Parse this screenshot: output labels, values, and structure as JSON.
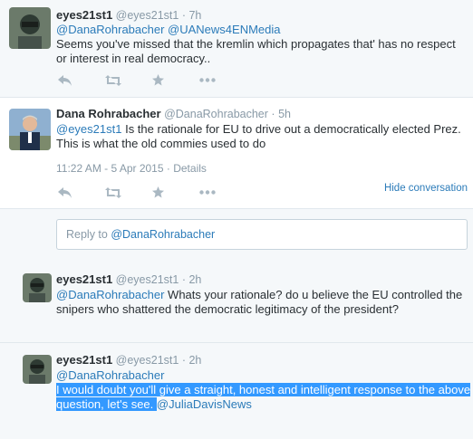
{
  "tweets": [
    {
      "fullname": "eyes21st1",
      "handle": "@eyes21st1",
      "time": "7h",
      "mentions": "@DanaRohrabacher @UANews4ENMedia",
      "text_line1": "Seems you've missed that the kremlin which propagates that' has no respect",
      "text_line2": "or interest in real democracy.."
    },
    {
      "fullname": "Dana Rohrabacher",
      "handle": "@DanaRohrabacher",
      "time": "5h",
      "mention": "@eyes21st1",
      "text_line1": " Is the rationale for EU to drive out a democratically elected Prez.",
      "text_line2": "This is what the old commies used to do",
      "timestamp": "11:22 AM - 5 Apr 2015",
      "details": "Details",
      "hide_conversation": "Hide conversation"
    },
    {
      "fullname": "eyes21st1",
      "handle": "@eyes21st1",
      "time": "2h",
      "mention": "@DanaRohrabacher",
      "text_line1": " Whats your rationale? do u believe the EU controlled the",
      "text_line2": "snipers who shattered the democratic legitimacy of the president?"
    },
    {
      "fullname": "eyes21st1",
      "handle": "@eyes21st1",
      "time": "2h",
      "mention": "@DanaRohrabacher",
      "text_line1": "I would doubt you'll give a straight, honest and intelligent response to the above",
      "text_line2": "question, let's see. ",
      "mention2": "@JuliaDavisNews"
    }
  ],
  "reply_box": {
    "prefix": "Reply to ",
    "mention": "@DanaRohrabacher"
  },
  "separator_dot": "·",
  "icons": [
    "reply-icon",
    "retweet-icon",
    "favorite-icon",
    "more-icon"
  ],
  "colors": {
    "link": "#2b7bb9",
    "muted": "#8899a6",
    "selection": "#3399ff"
  }
}
